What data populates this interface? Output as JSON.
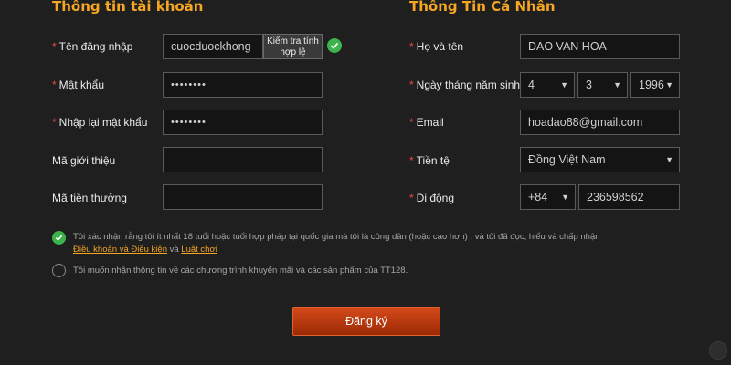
{
  "account": {
    "title": "Thông tin tài khoản",
    "username": {
      "label": "Tên đăng nhập",
      "value": "cuocduockhong"
    },
    "check_button": [
      "Kiểm tra tính",
      "hợp lệ"
    ],
    "password": {
      "label": "Mật khẩu",
      "value": "••••••••"
    },
    "confirm": {
      "label": "Nhập lại mật khẩu",
      "value": "••••••••"
    },
    "referral": {
      "label": "Mã giới thiệu",
      "value": ""
    },
    "bonus": {
      "label": "Mã tiền thưởng",
      "value": ""
    }
  },
  "personal": {
    "title": "Thông Tin Cá Nhân",
    "fullname": {
      "label": "Họ và tên",
      "value": "DAO VAN HOA"
    },
    "dob": {
      "label": "Ngày tháng năm sinh",
      "day": "4",
      "month": "3",
      "year": "1996"
    },
    "email": {
      "label": "Email",
      "value": "hoadao88@gmail.com"
    },
    "currency": {
      "label": "Tiền tệ",
      "value": "Đồng Việt Nam"
    },
    "mobile": {
      "label": "Di động",
      "code": "+84",
      "number": "236598562"
    }
  },
  "terms": {
    "line1": "Tôi xác nhận rằng tôi ít nhất 18 tuổi hoặc tuổi hợp pháp tại quốc gia mà tôi là công dân (hoặc cao hơn) , và tôi đã đọc, hiểu và chấp nhận",
    "link1": "Điều khoản và Điều kiện",
    "and": " và ",
    "link2": "Luật chơi",
    "promo": "Tôi muốn nhận thông tin về các chương trình khuyến mãi và các sản phẩm của TT128."
  },
  "submit_label": "Đăng ký",
  "colors": {
    "accent": "#f5a623",
    "button": "#c0390f",
    "success": "#3cb44b",
    "required": "#e84a3c"
  }
}
